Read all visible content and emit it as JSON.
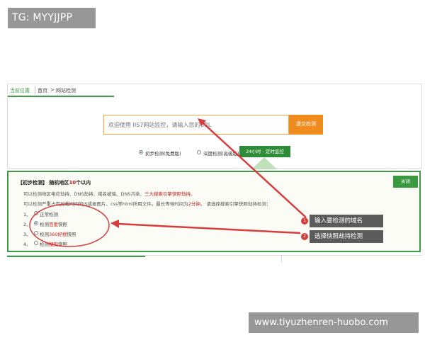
{
  "tag_badge": "TG: MYYJJPP",
  "breadcrumb": {
    "current": "当前位置",
    "home": "首页",
    "arrow": ">",
    "page": "网站检测"
  },
  "search": {
    "placeholder": "欢迎使用 IIS7网站监控，请输入您的URL",
    "submit_label": "提交检测"
  },
  "modes": [
    {
      "label": "初步检测(免费版)",
      "selected": true
    },
    {
      "label": "深度检测(高级版)",
      "selected": false
    }
  ],
  "monitor_label": "24小时 - 定时监控",
  "panel": {
    "title_prefix": "【初步检测】 随机地区",
    "title_count": "10",
    "title_suffix": "个以内",
    "close_label": "关闭",
    "desc1_a": "可以检测地区电信劫持、DNS劫持、域名被墙、DNS污染、",
    "desc1_b": "三大搜索引擎快照劫持。",
    "desc2_a": "可以检测严重占用加载时间的JS或者图片、css等html所用文件。最长等待时间为",
    "desc2_b": "2分钟",
    "desc2_c": "。 请选择搜索引擎快照劫持检测：",
    "options": [
      {
        "num": "1、",
        "pre": "正常检测",
        "hl": "",
        "post": "",
        "selected": false
      },
      {
        "num": "2、",
        "pre": "检测",
        "hl": "百度",
        "post": "快照",
        "selected": true
      },
      {
        "num": "3、",
        "pre": "检测",
        "hl": "360好搜",
        "post": "快照",
        "selected": false
      },
      {
        "num": "4、",
        "pre": "检测",
        "hl": "搜狗",
        "post": "快照",
        "selected": false
      }
    ]
  },
  "callouts": [
    {
      "num": "1",
      "label": "输入要检测的域名"
    },
    {
      "num": "2",
      "label": "选择快照劫持检测"
    }
  ],
  "watermark": "www.tiyuzhenren-huobo.com",
  "colors": {
    "accent_green": "#3e9a44",
    "orange": "#f08c1e",
    "annotation_red": "#d83c3c",
    "callout_gray": "#5b5b5b"
  }
}
